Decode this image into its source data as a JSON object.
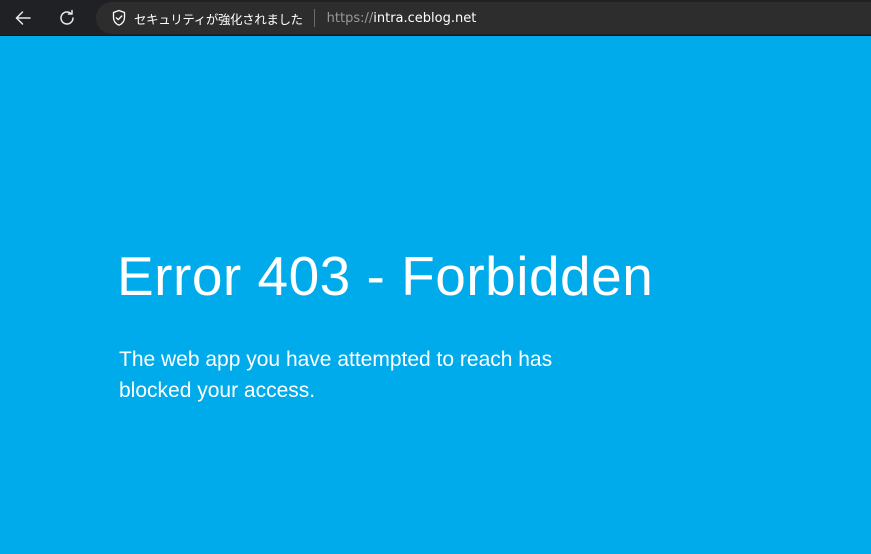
{
  "browser": {
    "back_icon": "arrow-left-icon",
    "reload_icon": "reload-icon",
    "security_icon": "shield-check-icon",
    "security_label": "セキュリティが強化されました",
    "url_scheme": "https://",
    "url_host": "intra.ceblog.net"
  },
  "page": {
    "title": "Error 403 - Forbidden",
    "message": "The web app you have attempted to reach has blocked your access."
  },
  "colors": {
    "page_background": "#00abeb",
    "toolbar_background": "#202124",
    "address_bar_background": "#2d2d2d",
    "text": "#ffffff"
  }
}
